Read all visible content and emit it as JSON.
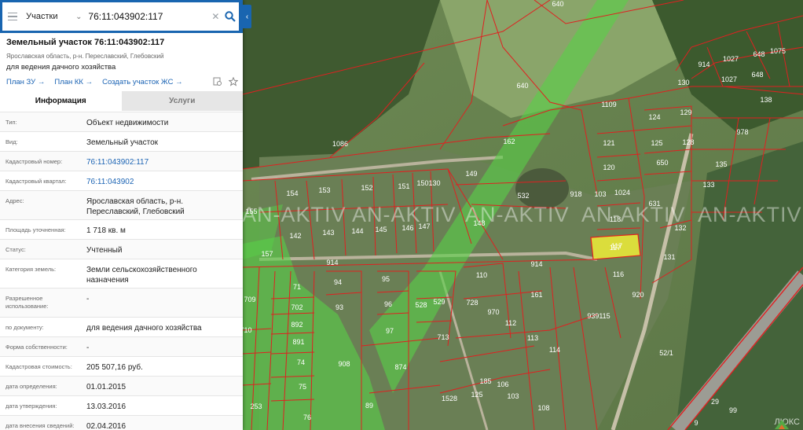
{
  "search": {
    "layer": "Участки",
    "query": "76:11:043902:117"
  },
  "object": {
    "title": "Земельный участок 76:11:043902:117",
    "address_line": "Ярославская область, р-н. Переславский, Глебовский",
    "purpose": "для ведения дачного хозяйства",
    "links": [
      "План ЗУ →",
      "План КК →",
      "Создать участок ЖС →"
    ]
  },
  "tabs": [
    "Информация",
    "Услуги"
  ],
  "info_rows": [
    {
      "key": "Тип:",
      "value": "Объект недвижимости"
    },
    {
      "key": "Вид:",
      "value": "Земельный участок"
    },
    {
      "key": "Кадастровый номер:",
      "value": "76:11:043902:117",
      "link": true
    },
    {
      "key": "Кадастровый квартал:",
      "value": "76:11:043902",
      "link": true
    },
    {
      "key": "Адрес:",
      "value": "Ярославская область, р-н. Переславский, Глебовский",
      "tall": true
    },
    {
      "key": "Площадь уточненная:",
      "value": "1 718 кв. м"
    },
    {
      "key": "Статус:",
      "value": "Учтенный"
    },
    {
      "key": "Категория земель:",
      "value": "Земли сельскохозяйственного назначения",
      "tall": true
    },
    {
      "key": "Разрешенное использование:",
      "value": "-",
      "tall": true
    },
    {
      "key": "по документу:",
      "value": "для ведения дачного хозяйства"
    },
    {
      "key": "Форма собственности:",
      "value": "-"
    },
    {
      "key": "Кадастровая стоимость:",
      "value": "205 507,16 руб."
    },
    {
      "key": "дата определения:",
      "value": "01.01.2015"
    },
    {
      "key": "дата утверждения:",
      "value": "13.03.2016"
    },
    {
      "key": "дата внесения сведений:",
      "value": "02.04.2016"
    }
  ],
  "map": {
    "watermark": "AN-AKTIV",
    "selected_plot": "117",
    "plot_labels": [
      "640",
      "640",
      "1086",
      "162",
      "149",
      "532",
      "918",
      "1109",
      "124",
      "129",
      "121",
      "125",
      "128",
      "120",
      "650",
      "1027",
      "1027",
      "648",
      "648",
      "1075",
      "914",
      "130",
      "138",
      "978",
      "135",
      "133",
      "154",
      "153",
      "152",
      "151",
      "150",
      "130",
      "103",
      "1024",
      "118",
      "631",
      "132",
      "142",
      "143",
      "144",
      "145",
      "146",
      "147",
      "148",
      "155",
      "157",
      "914",
      "117",
      "131",
      "116",
      "110",
      "914",
      "71",
      "94",
      "95",
      "702",
      "93",
      "96",
      "528",
      "529",
      "728",
      "970",
      "161",
      "939115",
      "112",
      "113",
      "114",
      "892",
      "891",
      "74",
      "75",
      "76",
      "908",
      "97",
      "713",
      "874",
      "253",
      "89",
      "1528",
      "185",
      "125",
      "106",
      "103",
      "108",
      "709",
      "710",
      "920",
      "52/1",
      "29",
      "99",
      "9"
    ],
    "brand": "ЛЮКС"
  },
  "colors": {
    "header": "#1965b0",
    "link": "#1c64b4",
    "boundary": "#e02020",
    "zone": "#58d048",
    "selected": "#e8e83a"
  }
}
